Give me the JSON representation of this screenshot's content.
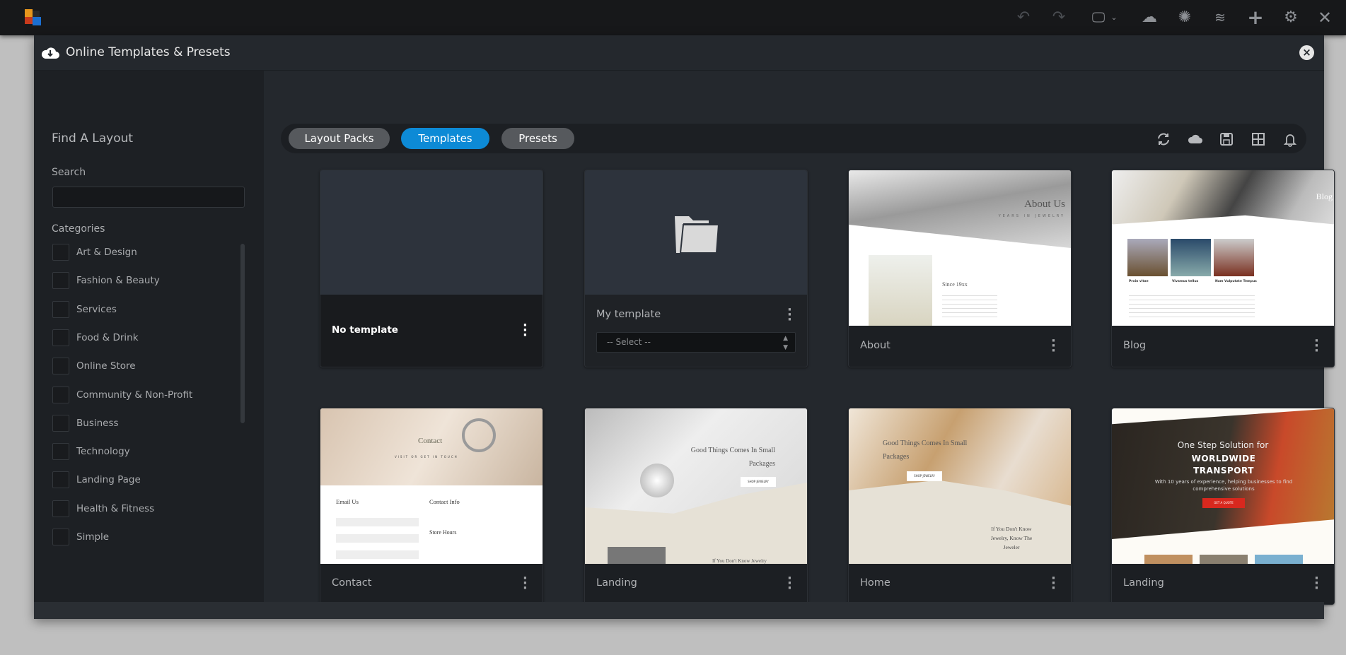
{
  "topbar": {
    "icons": [
      "undo-icon",
      "redo-icon",
      "monitor-icon",
      "cloud-download-icon",
      "help-icon",
      "layers-icon",
      "plus-icon",
      "gear-icon",
      "close-icon"
    ]
  },
  "modal": {
    "title": "Online Templates & Presets",
    "close_icon": "close-circle-icon"
  },
  "sidebar": {
    "title": "Find A Layout",
    "search_label": "Search",
    "search_value": "",
    "categories_label": "Categories",
    "categories": [
      "Art & Design",
      "Fashion & Beauty",
      "Services",
      "Food & Drink",
      "Online Store",
      "Community & Non-Profit",
      "Business",
      "Technology",
      "Landing Page",
      "Health & Fitness",
      "Simple"
    ]
  },
  "toolbar": {
    "tabs": [
      {
        "label": "Layout Packs",
        "active": false
      },
      {
        "label": "Templates",
        "active": true
      },
      {
        "label": "Presets",
        "active": false
      }
    ],
    "icons": [
      "refresh-icon",
      "cloud-icon",
      "save-icon",
      "grid-icon",
      "bell-icon"
    ],
    "accent_color": "#0d8ad6"
  },
  "cards": [
    {
      "name": "No template"
    },
    {
      "name": "My template",
      "select_value": "-- Select --"
    },
    {
      "name": "About",
      "preview": {
        "heading": "About Us",
        "sub": "YEARS IN JEWELRY",
        "text": "Since 19xx"
      }
    },
    {
      "name": "Blog",
      "preview": {
        "heading": "Blog",
        "posts": [
          "Proin vitae",
          "Vivamus tellus",
          "Nam Vulputate Tempus"
        ]
      }
    },
    {
      "name": "Contact",
      "preview": {
        "heading": "Contact",
        "sub": "VISIT OR GET IN TOUCH",
        "left": "Email Us",
        "right": "Contact Info",
        "right2": "Store Hours"
      }
    },
    {
      "name": "Landing",
      "preview": {
        "heading": "Good Things Comes In Small Packages",
        "button": "SHOP JEWELRY",
        "text": "If You Don't Know Jewelry"
      }
    },
    {
      "name": "Home",
      "preview": {
        "heading": "Good Things Comes In Small Packages",
        "button": "SHOP JEWELRY",
        "text": "If You Don't Know Jewelry, Know The Jeweler"
      }
    },
    {
      "name": "Landing",
      "preview": {
        "heading": "One Step Solution for",
        "heading2": "WORLDWIDE TRANSPORT",
        "sub": "With 10 years of experience, helping businesses to find comprehensive solutions",
        "button": "GET A QUOTE"
      }
    }
  ]
}
